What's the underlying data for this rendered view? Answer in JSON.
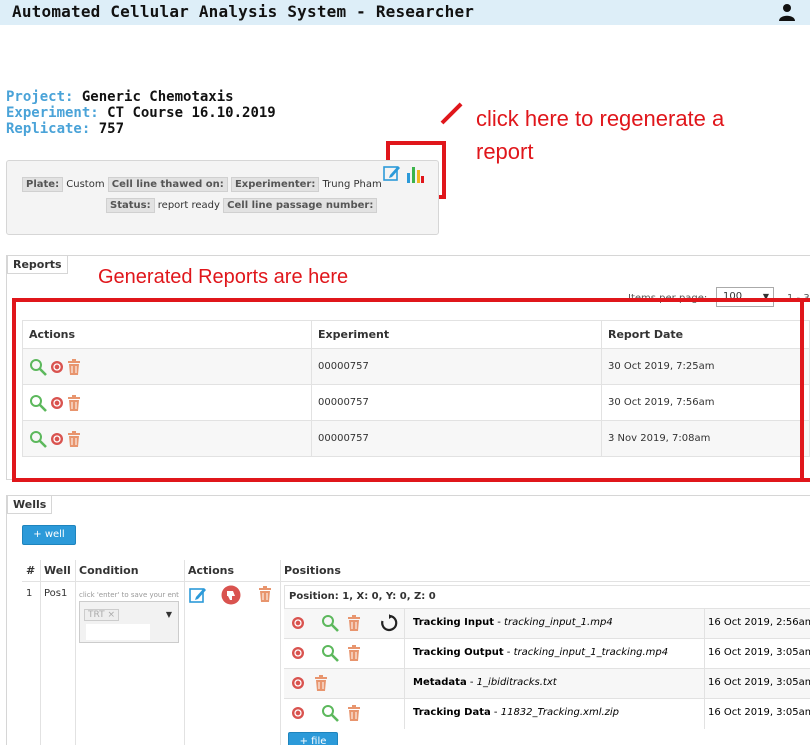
{
  "header": {
    "title": "Automated Cellular Analysis System - Researcher",
    "user_icon": "user-icon"
  },
  "project": {
    "project_label": "Project:",
    "project_value": "Generic Chemotaxis",
    "experiment_label": "Experiment:",
    "experiment_value": "CT Course 16.10.2019",
    "replicate_label": "Replicate:",
    "replicate_value": "757"
  },
  "plate": {
    "plate_label": "Plate:",
    "plate_value": "Custom",
    "cell_line_label": "Cell line thawed on:",
    "experimenter_label": "Experimenter:",
    "experimenter_value": "Trung Pham",
    "status_label": "Status:",
    "status_value": "report ready",
    "passage_label": "Cell line passage number:"
  },
  "annotations": {
    "regen": "click here to regenerate a report",
    "reports": "Generated Reports are here"
  },
  "reports": {
    "tab": "Reports",
    "items_per_page_label": "Items per page:",
    "items_per_page_value": "100",
    "pager_text": "1 - 3",
    "columns": [
      "Actions",
      "Experiment",
      "Report Date"
    ],
    "rows": [
      {
        "experiment": "00000757",
        "date": "30 Oct 2019, 7:25am"
      },
      {
        "experiment": "00000757",
        "date": "30 Oct 2019, 7:56am"
      },
      {
        "experiment": "00000757",
        "date": "3 Nov 2019, 7:08am"
      }
    ]
  },
  "wells": {
    "tab": "Wells",
    "add_well": "+ well",
    "columns": [
      "#",
      "Well",
      "Condition",
      "Actions",
      "Positions"
    ],
    "row": {
      "num": "1",
      "well": "Pos1",
      "condition_hint": "click 'enter' to save your entry",
      "condition_tag": "TRT"
    },
    "position_title": "Position: 1, X: 0, Y: 0, Z: 0",
    "files": [
      {
        "type": "Tracking Input",
        "name": "tracking_input_1.mp4",
        "date": "16 Oct 2019, 2:56am"
      },
      {
        "type": "Tracking Output",
        "name": "tracking_input_1_tracking.mp4",
        "date": "16 Oct 2019, 3:05am"
      },
      {
        "type": "Metadata",
        "name": "1_ibiditracks.txt",
        "date": "16 Oct 2019, 3:05am"
      },
      {
        "type": "Tracking Data",
        "name": "11832_Tracking.xml.zip",
        "date": "16 Oct 2019, 3:05am"
      }
    ],
    "add_file": "+ file"
  },
  "colors": {
    "accent": "#4aa3d8",
    "annotation": "#e0161b",
    "button": "#2c9ad9",
    "topbar": "#ddeef8"
  }
}
